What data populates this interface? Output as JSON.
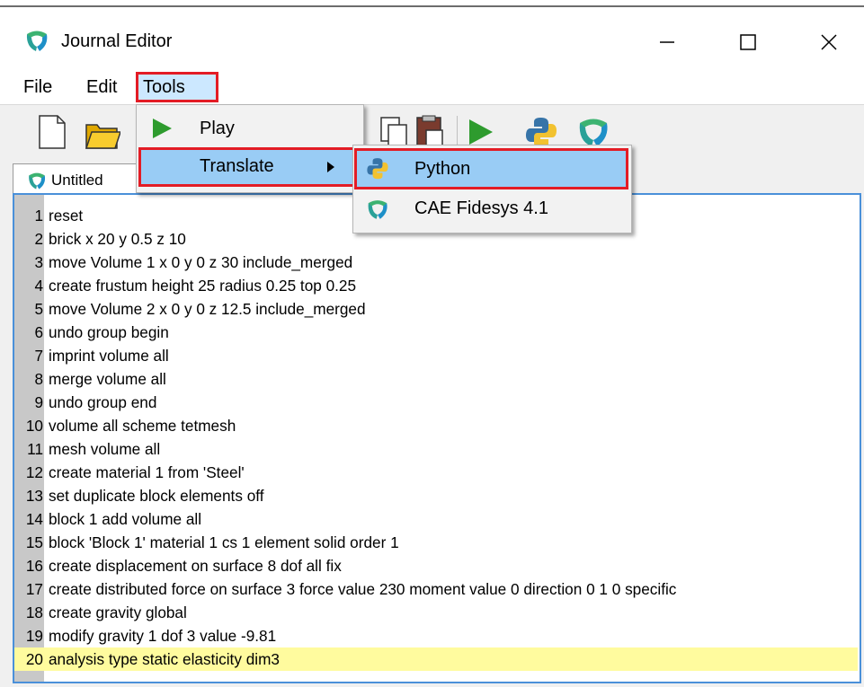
{
  "window": {
    "title": "Journal Editor",
    "controls": [
      "minimize",
      "maximize",
      "close"
    ]
  },
  "menubar": {
    "file": "File",
    "edit": "Edit",
    "tools": "Tools"
  },
  "toolbar": {
    "icons": [
      "new-file-icon",
      "open-folder-icon",
      "copy-icon",
      "paste-icon",
      "play-icon",
      "python-icon",
      "fidesys-icon"
    ]
  },
  "tabs": [
    {
      "label": "Untitled"
    }
  ],
  "tools_menu": {
    "items": [
      {
        "label": "Play",
        "icon": "play-icon"
      },
      {
        "label": "Translate",
        "has_submenu": true,
        "highlighted": true
      }
    ]
  },
  "translate_submenu": {
    "items": [
      {
        "label": "Python",
        "icon": "python-icon",
        "highlighted": true
      },
      {
        "label": "CAE Fidesys 4.1",
        "icon": "fidesys-icon"
      }
    ]
  },
  "editor": {
    "highlighted_line": "20",
    "lines": [
      {
        "n": "1",
        "code": "reset"
      },
      {
        "n": "2",
        "code": "brick x 20 y 0.5 z 10"
      },
      {
        "n": "3",
        "code": "move Volume 1  x 0 y 0 z 30 include_merged"
      },
      {
        "n": "4",
        "code": "create frustum height 25 radius 0.25 top 0.25"
      },
      {
        "n": "5",
        "code": "move Volume 2 x 0 y 0 z 12.5 include_merged"
      },
      {
        "n": "6",
        "code": "undo group begin"
      },
      {
        "n": "7",
        "code": "imprint volume all"
      },
      {
        "n": "8",
        "code": "merge volume all"
      },
      {
        "n": "9",
        "code": "undo group end"
      },
      {
        "n": "10",
        "code": "volume all scheme tetmesh"
      },
      {
        "n": "11",
        "code": "mesh volume all"
      },
      {
        "n": "12",
        "code": "create material 1 from 'Steel'"
      },
      {
        "n": "13",
        "code": "set duplicate block elements off"
      },
      {
        "n": "14",
        "code": "block 1 add volume all"
      },
      {
        "n": "15",
        "code": "block 'Block 1' material 1 cs 1 element solid order 1"
      },
      {
        "n": "16",
        "code": "create displacement  on surface 8  dof all fix"
      },
      {
        "n": "17",
        "code": "create distributed force on surface 3  force value 230 moment value 0 direction 0 1 0 specific"
      },
      {
        "n": "18",
        "code": "create gravity global"
      },
      {
        "n": "19",
        "code": "modify gravity 1 dof 3 value -9.81"
      },
      {
        "n": "20",
        "code": "analysis type static elasticity dim3"
      }
    ]
  },
  "colors": {
    "highlight_outline": "#e31c25",
    "menu_selection": "#99ccf5",
    "editor_border": "#4a90d9",
    "current_line": "#fffb9e",
    "play_green": "#2e9b2e"
  }
}
